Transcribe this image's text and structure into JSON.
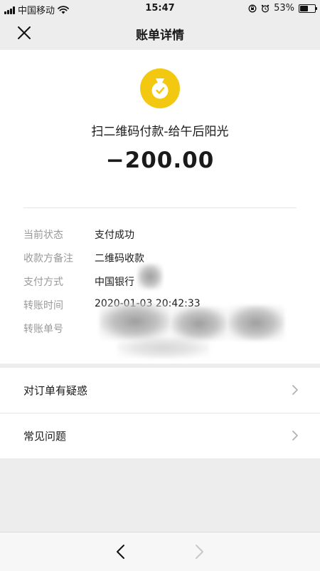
{
  "status_bar": {
    "carrier": "中国移动",
    "time": "15:47",
    "battery": "53%",
    "battery_level": 0.53
  },
  "nav": {
    "title": "账单详情",
    "close_icon": "close-icon"
  },
  "bill": {
    "merchant_icon": "money-bag-icon",
    "merchant": "扫二维码付款-给午后阳光",
    "amount": "−200.00",
    "accent_color": "#f2c811"
  },
  "details": [
    {
      "label": "当前状态",
      "value": "支付成功"
    },
    {
      "label": "收款方备注",
      "value": "二维码收款"
    },
    {
      "label": "支付方式",
      "value": "中国银行"
    },
    {
      "label": "转账时间",
      "value": "2020-01-03 20:42:33"
    },
    {
      "label": "转账单号",
      "value": ""
    }
  ],
  "menu": [
    {
      "label": "对订单有疑惑",
      "icon": "chevron-right-icon"
    },
    {
      "label": "常见问题",
      "icon": "chevron-right-icon"
    }
  ],
  "bottom_nav": {
    "back_icon": "back-arrow-icon",
    "forward_icon": "forward-arrow-icon"
  }
}
